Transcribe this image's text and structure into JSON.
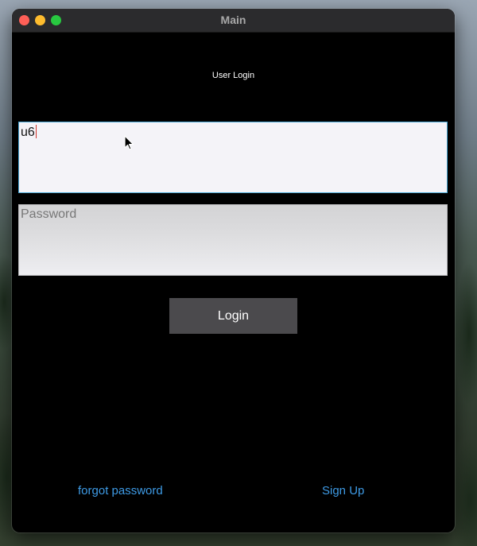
{
  "window": {
    "title": "Main"
  },
  "heading": "User Login",
  "username": {
    "value": "u6"
  },
  "password": {
    "placeholder": "Password"
  },
  "login_button": {
    "label": "Login"
  },
  "links": {
    "forgot_password": "forgot password",
    "sign_up": "Sign Up"
  },
  "colors": {
    "accent_link": "#3e9be6",
    "focus_border": "#4aa8d6",
    "button_bg": "#4b4a4d",
    "window_bg": "#000000"
  }
}
